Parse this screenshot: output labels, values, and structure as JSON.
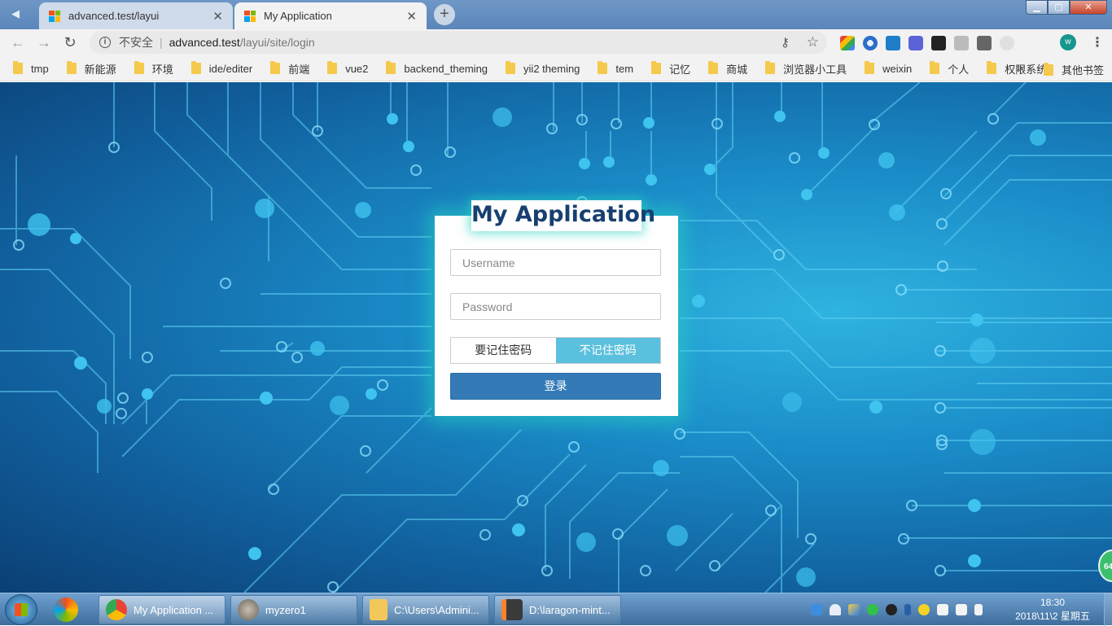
{
  "browser": {
    "tabs": [
      {
        "title": "advanced.test/layui",
        "close": "✕"
      },
      {
        "title": "My Application",
        "close": "✕"
      }
    ],
    "new_tab": "+",
    "nav": {
      "back": "←",
      "forward": "→",
      "reload": "↻"
    },
    "omnibox": {
      "info": "i",
      "security": "不安全",
      "separator": "|",
      "host": "advanced.test",
      "path": "/layui/site/login"
    },
    "avatar_letter": "w",
    "menu": "⋮"
  },
  "bookmarks": {
    "items": [
      "tmp",
      "新能源",
      "环境",
      "ide/editer",
      "前端",
      "vue2",
      "backend_theming",
      "yii2 theming",
      "tem",
      "记忆",
      "商城",
      "浏览器小工具",
      "weixin",
      "个人",
      "权限系统"
    ],
    "more": "»",
    "other": "其他书签"
  },
  "login": {
    "title": "My Application",
    "username_placeholder": "Username",
    "password_placeholder": "Password",
    "remember_on": "要记住密码",
    "remember_off": "不记住密码",
    "submit": "登录"
  },
  "badge": "64",
  "taskbar": {
    "tasks": [
      {
        "label": "My Application ..."
      },
      {
        "label": "myzero1"
      },
      {
        "label": "C:\\Users\\Admini..."
      },
      {
        "label": "D:\\laragon-mint..."
      }
    ],
    "time": "18:30",
    "date": "2018\\11\\2 星期五"
  },
  "colors": {
    "accent": "#5bc0de",
    "primary_button": "#337ab7",
    "title_text": "#173f70",
    "glow": "#28d2be"
  }
}
